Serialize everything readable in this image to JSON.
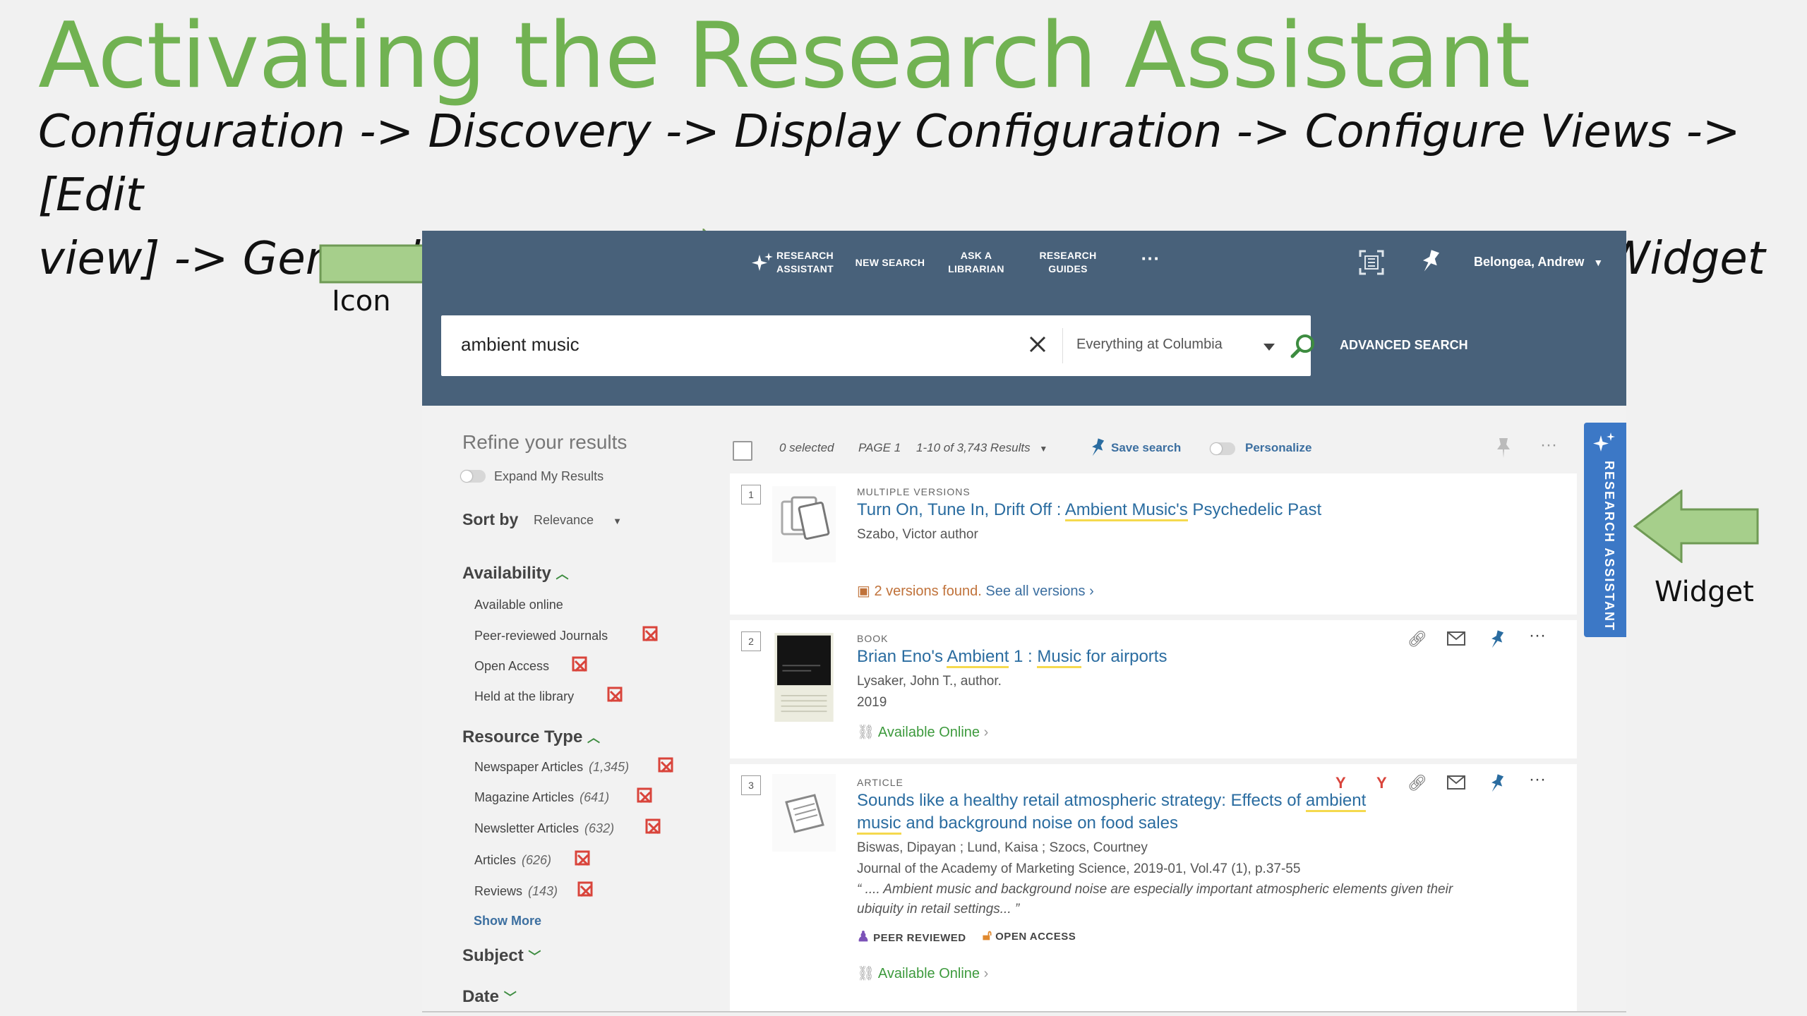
{
  "slide": {
    "title": "Activating the Research Assistant",
    "path_line1": "Configuration -> Discovery -> Display Configuration -> Configure Views -> [Edit",
    "path_line2": "view] -> General Attributes -> Enable Research Assistant Using Icon/Widget",
    "icon_callout": "Icon",
    "widget_callout": "Widget"
  },
  "topbar": {
    "nav": [
      {
        "line1": "Research",
        "line2": "Assistant"
      },
      {
        "line1": "New Search",
        "line2": ""
      },
      {
        "line1": "Ask a",
        "line2": "Librarian"
      },
      {
        "line1": "Research",
        "line2": "Guides"
      }
    ],
    "more": "···",
    "user": "Belongea, Andrew"
  },
  "search": {
    "value": "ambient music",
    "scope": "Everything at Columbia",
    "advanced": "ADVANCED SEARCH"
  },
  "facets": {
    "refine_title": "Refine your results",
    "expand_label": "Expand My Results",
    "sort_label": "Sort by",
    "sort_value": "Relevance",
    "availability": {
      "title": "Availability",
      "items": [
        "Available online",
        "Peer-reviewed Journals",
        "Open Access",
        "Held at the library"
      ]
    },
    "resource_type": {
      "title": "Resource Type",
      "items": [
        {
          "label": "Newspaper Articles",
          "count": "(1,345)"
        },
        {
          "label": "Magazine Articles",
          "count": "(641)"
        },
        {
          "label": "Newsletter Articles",
          "count": "(632)"
        },
        {
          "label": "Articles",
          "count": "(626)"
        },
        {
          "label": "Reviews",
          "count": "(143)"
        }
      ],
      "show_more": "Show More"
    },
    "subject_title": "Subject",
    "date_title": "Date"
  },
  "results_toolbar": {
    "selected": "0 selected",
    "page": "PAGE 1",
    "range": "1-10 of 3,743 Results",
    "save_search": "Save search",
    "personalize": "Personalize"
  },
  "results": [
    {
      "num": "1",
      "type": "Multiple versions",
      "title_parts": [
        "Turn On, Tune In, Drift Off : ",
        "Ambient Music's",
        " Psychedelic Past"
      ],
      "author": "Szabo, Victor author",
      "versions": "2 versions found.",
      "see_all": "See all versions"
    },
    {
      "num": "2",
      "type": "Book",
      "title_parts": [
        "Brian Eno's ",
        "Ambient",
        " 1 : ",
        "Music",
        " for airports"
      ],
      "author": "Lysaker, John T., author.",
      "year": "2019",
      "availability": "Available Online"
    },
    {
      "num": "3",
      "type": "Article",
      "title_parts": [
        "Sounds like a healthy retail atmospheric strategy: Effects of ",
        "ambient",
        "music",
        " and background noise on food sales"
      ],
      "author": "Biswas, Dipayan ; Lund, Kaisa ; Szocs, Courtney",
      "source": "Journal of the Academy of Marketing Science, 2019-01, Vol.47 (1), p.37-55",
      "snippet_line1": "“ .... Ambient music and background noise are especially important atmospheric elements given their",
      "snippet_line2": "ubiquity in retail settings... ”",
      "badge_peer": "PEER REVIEWED",
      "badge_oa": "OPEN ACCESS",
      "availability": "Available Online"
    }
  ],
  "widget": {
    "label": "RESEARCH ASSISTANT"
  },
  "colors": {
    "title_green": "#71b252",
    "arrow_green": "#a6cf8b",
    "topbar": "#48617a",
    "link_blue": "#2a6ca0",
    "widget_blue": "#3c78c6"
  }
}
